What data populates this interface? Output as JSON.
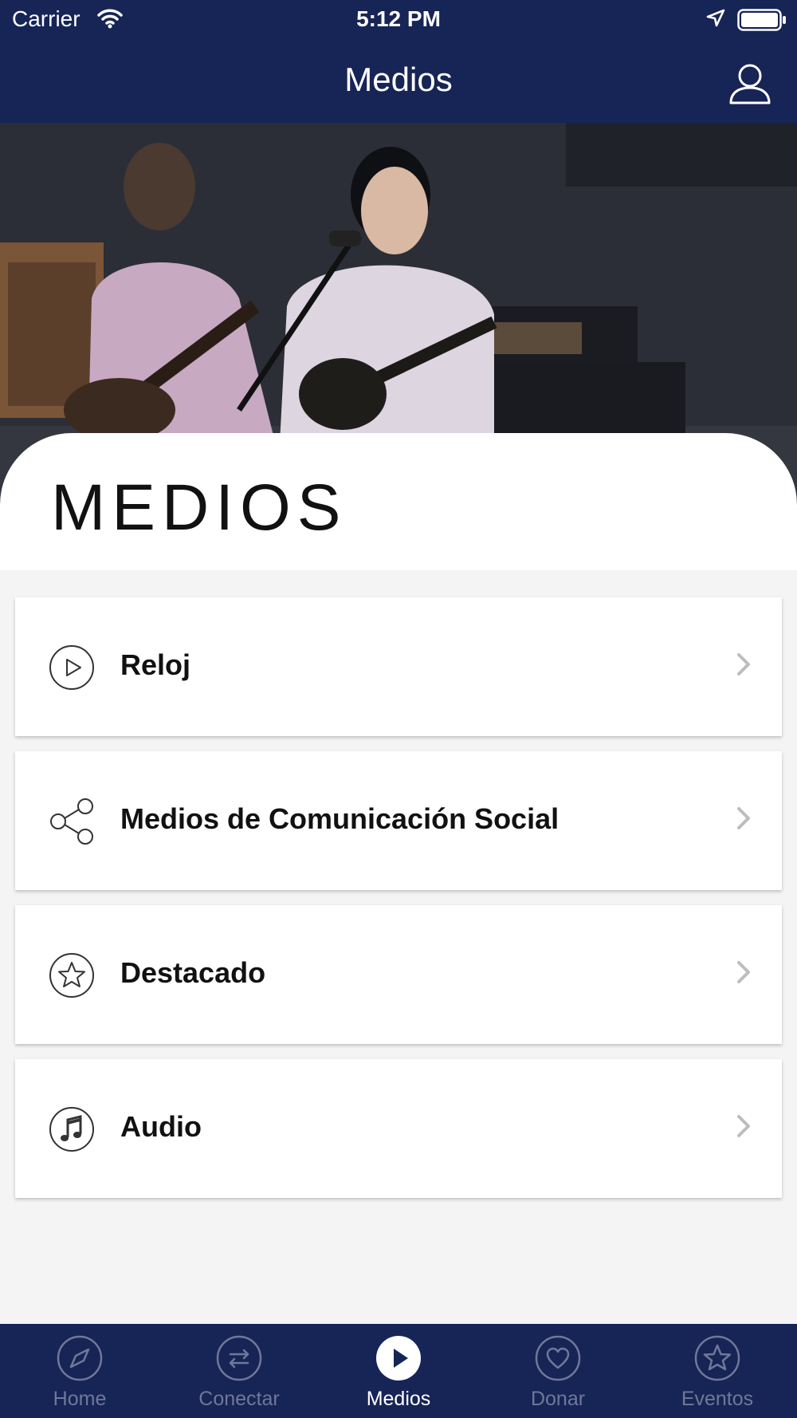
{
  "status_bar": {
    "carrier": "Carrier",
    "time": "5:12 PM"
  },
  "header": {
    "title": "Medios"
  },
  "hero": {
    "title": "MEDIOS"
  },
  "menu_items": [
    {
      "label": "Reloj",
      "icon": "play-circle-icon"
    },
    {
      "label": "Medios de Comunicación Social",
      "icon": "share-icon"
    },
    {
      "label": "Destacado",
      "icon": "star-circle-icon"
    },
    {
      "label": "Audio",
      "icon": "music-note-icon"
    }
  ],
  "tabs": [
    {
      "label": "Home",
      "icon": "compass-icon",
      "active": false
    },
    {
      "label": "Conectar",
      "icon": "swap-arrows-icon",
      "active": false
    },
    {
      "label": "Medios",
      "icon": "play-icon",
      "active": true
    },
    {
      "label": "Donar",
      "icon": "heart-icon",
      "active": false
    },
    {
      "label": "Eventos",
      "icon": "star-icon",
      "active": false
    }
  ],
  "colors": {
    "nav_background": "#172456",
    "page_background": "#f4f4f4",
    "tab_inactive": "#6f7898",
    "tab_active": "#ffffff"
  }
}
